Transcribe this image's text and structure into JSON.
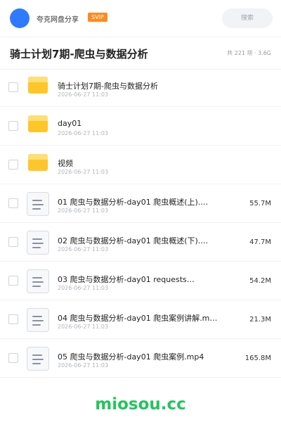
{
  "header": {
    "user": "夸克网盘分享",
    "badge": "SVIP",
    "search_placeholder": "搜索"
  },
  "page": {
    "title": "骑士计划7期-爬虫与数据分析",
    "meta": "共 221 项 · 3.6G"
  },
  "files": [
    {
      "type": "folder",
      "name": "骑士计划7期-爬虫与数据分析",
      "date": "2026-06-27 11:03",
      "size": ""
    },
    {
      "type": "folder",
      "name": "day01",
      "date": "2026-06-27 11:03",
      "size": ""
    },
    {
      "type": "folder",
      "name": "视频",
      "date": "2026-06-27 11:03",
      "size": ""
    },
    {
      "type": "file",
      "name": "01 爬虫与数据分析-day01 爬虫概述(上).…",
      "date": "2026-06-27 11:03",
      "size": "55.7M"
    },
    {
      "type": "file",
      "name": "02 爬虫与数据分析-day01 爬虫概述(下).…",
      "date": "2026-06-27 11:03",
      "size": "47.7M"
    },
    {
      "type": "file",
      "name": "03 爬虫与数据分析-day01 requests…",
      "date": "2026-06-27 11:03",
      "size": "54.2M"
    },
    {
      "type": "file",
      "name": "04 爬虫与数据分析-day01 爬虫案例讲解.m…",
      "date": "2026-06-27 11:03",
      "size": "21.3M"
    },
    {
      "type": "file",
      "name": "05 爬虫与数据分析-day01 爬虫案例.mp4",
      "date": "2026-06-27 11:03",
      "size": "165.8M"
    }
  ],
  "watermark": "miosou.cc",
  "colors": {
    "accent": "#2f7bff",
    "svip": "#ff8a1f",
    "folder": "#ffc629",
    "watermark": "#22c55e"
  }
}
